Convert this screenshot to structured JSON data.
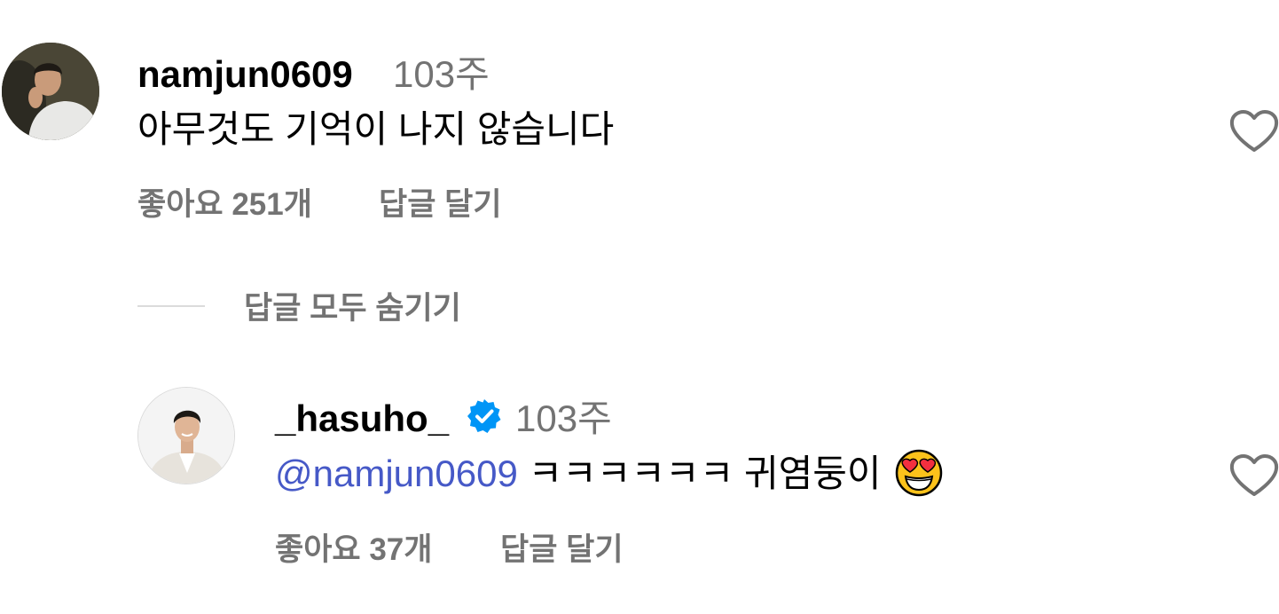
{
  "comment": {
    "username": "namjun0609",
    "time": "103주",
    "text": "아무것도 기억이 나지 않습니다",
    "likes_label": "좋아요 251개",
    "reply_label": "답글 달기",
    "avatar_icon": "user-photo-avatar",
    "heart_icon": "heart-outline-icon"
  },
  "replies_toggle": {
    "label": "답글 모두 숨기기"
  },
  "reply": {
    "username": "_hasuho_",
    "verified_icon": "verified-badge-icon",
    "verified_color": "#0095f6",
    "time": "103주",
    "mention": "@namjun0609",
    "text": " ㅋㅋㅋㅋㅋㅋ 귀염둥이 ",
    "emoji": "heart-eyes-emoji",
    "likes_label": "좋아요 37개",
    "reply_label": "답글 달기",
    "avatar_icon": "user-photo-avatar",
    "heart_icon": "heart-outline-icon"
  },
  "colors": {
    "primary_text": "#000000",
    "secondary_text": "#737373",
    "mention": "#4659c7",
    "divider": "#dbdbdb"
  }
}
